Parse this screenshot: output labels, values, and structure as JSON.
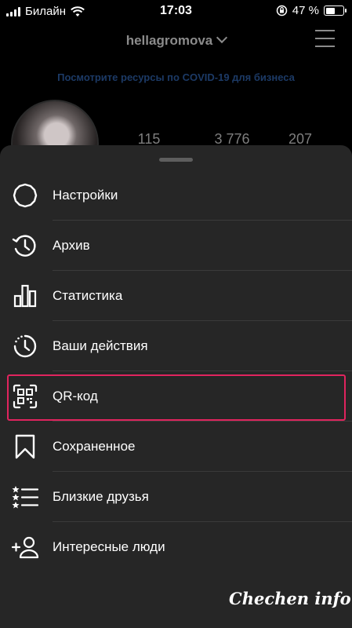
{
  "status_bar": {
    "carrier": "Билайн",
    "time": "17:03",
    "battery_percent": "47 %",
    "battery_level": 0.47,
    "icons": [
      "signal-icon",
      "wifi-icon",
      "orientation-lock-icon",
      "battery-icon"
    ]
  },
  "profile": {
    "username": "hellagromova",
    "covid_link": "Посмотрите ресурсы по COVID-19 для бизнеса",
    "stats": [
      "115",
      "3 776",
      "207"
    ]
  },
  "menu": {
    "items": [
      {
        "label": "Настройки",
        "icon": "settings-gear-icon"
      },
      {
        "label": "Архив",
        "icon": "archive-clock-icon"
      },
      {
        "label": "Статистика",
        "icon": "bar-chart-icon"
      },
      {
        "label": "Ваши действия",
        "icon": "activity-clock-icon"
      },
      {
        "label": "QR-код",
        "icon": "qr-code-icon"
      },
      {
        "label": "Сохраненное",
        "icon": "bookmark-icon"
      },
      {
        "label": "Близкие друзья",
        "icon": "close-friends-list-icon"
      },
      {
        "label": "Интересные люди",
        "icon": "add-person-icon"
      }
    ],
    "highlighted_index": 4,
    "highlight_color": "#e0245e"
  },
  "watermark": "Chechen info"
}
